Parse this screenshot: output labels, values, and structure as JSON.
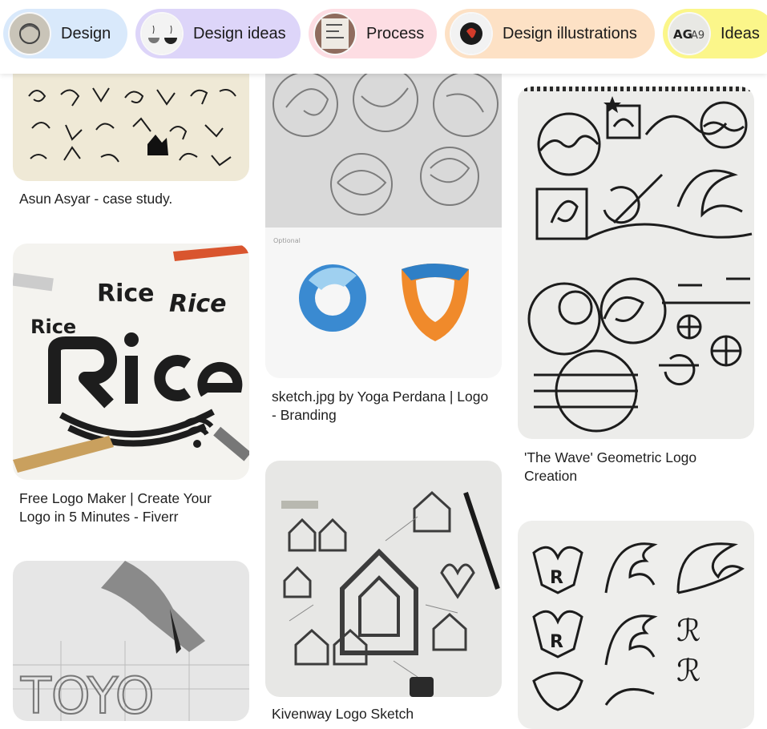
{
  "chips": [
    {
      "label": "Design",
      "color": "#d9e9fb"
    },
    {
      "label": "Design ideas",
      "color": "#ddd5f9"
    },
    {
      "label": "Process",
      "color": "#fddde3"
    },
    {
      "label": "Design illustrations",
      "color": "#fde1c5"
    },
    {
      "label": "Ideas",
      "color": "#fbf68a"
    }
  ],
  "pins": [
    {
      "title": "Asun Asyar - case study."
    },
    {
      "title": "Free Logo Maker | Create Your Logo in 5 Minutes - Fiverr"
    },
    {
      "title": ""
    },
    {
      "title": "sketch.jpg by Yoga Perdana | Logo - Branding"
    },
    {
      "title": "Kivenway Logo Sketch"
    },
    {
      "title": "'The Wave' Geometric Logo Creation"
    },
    {
      "title": ""
    }
  ],
  "images": {
    "rice_logo_text": "Rice",
    "sketch_optional_text": "Optional",
    "toyo_text": "TOYO"
  }
}
